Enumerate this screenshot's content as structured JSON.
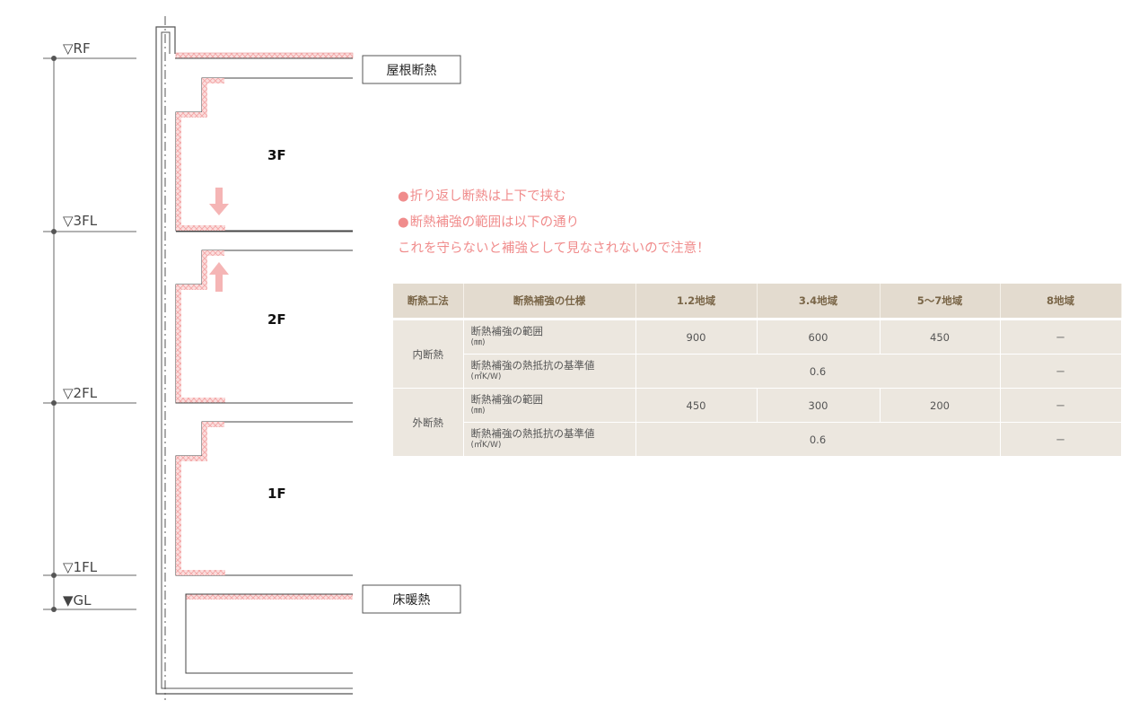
{
  "levels": [
    {
      "label": "▽RF"
    },
    {
      "label": "▽3FL"
    },
    {
      "label": "▽2FL"
    },
    {
      "label": "▽1FL"
    },
    {
      "label": "▼GL"
    }
  ],
  "floors": [
    "3F",
    "2F",
    "1F"
  ],
  "callouts": {
    "roof": "屋根断熱",
    "floor": "床暖熱"
  },
  "notes": {
    "bullet": "●",
    "line1": "折り返し断熱は上下で挟む",
    "line2": "断熱補強の範囲は以下の通り",
    "line3": "これを守らないと補強として見なされないので注意！"
  },
  "colors": {
    "insulation": "#f3a6a6",
    "note_text": "#f08c8c",
    "table_header_bg": "#e3dbcf",
    "table_body_bg": "#ece7df",
    "arrow": "#f5b5b5"
  },
  "table": {
    "headers": [
      "断熱工法",
      "断熱補強の仕様",
      "1.2地域",
      "3.4地域",
      "5〜7地域",
      "8地域"
    ],
    "groups": [
      {
        "method": "内断熱",
        "rows": [
          {
            "spec": "断熱補強の範囲",
            "unit": "(㎜)",
            "v12": "900",
            "v34": "600",
            "v57": "450",
            "v8": "－"
          },
          {
            "spec": "断熱補強の熱抵抗の基準値",
            "unit": "(㎡K/W)",
            "merged": "0.6",
            "v8": "－"
          }
        ]
      },
      {
        "method": "外断熱",
        "rows": [
          {
            "spec": "断熱補強の範囲",
            "unit": "(㎜)",
            "v12": "450",
            "v34": "300",
            "v57": "200",
            "v8": "－"
          },
          {
            "spec": "断熱補強の熱抵抗の基準値",
            "unit": "(㎡K/W)",
            "merged": "0.6",
            "v8": "－"
          }
        ]
      }
    ]
  }
}
